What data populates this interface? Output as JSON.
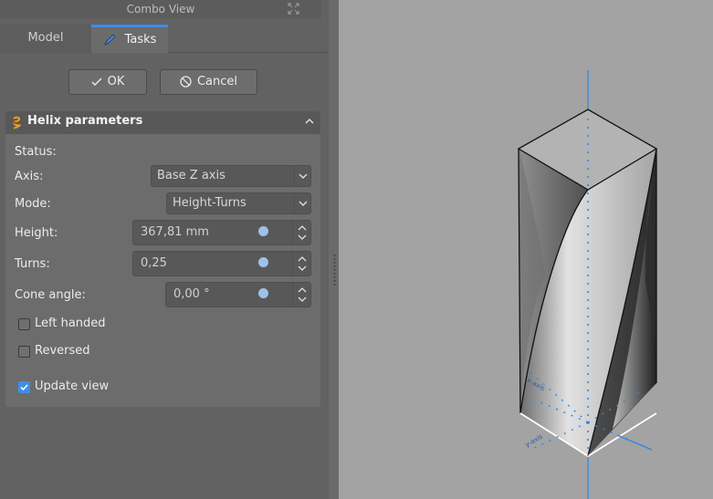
{
  "combo_view": {
    "title": "Combo View",
    "tabs": {
      "model": "Model",
      "tasks": "Tasks"
    }
  },
  "buttons": {
    "ok": "OK",
    "cancel": "Cancel"
  },
  "panel": {
    "title": "Helix parameters",
    "status_label": "Status:",
    "axis_label": "Axis:",
    "axis_value": "Base Z axis",
    "mode_label": "Mode:",
    "mode_value": "Height-Turns",
    "height_label": "Height:",
    "height_value": "367,81 mm",
    "turns_label": "Turns:",
    "turns_value": "0,25",
    "cone_label": "Cone angle:",
    "cone_value": "0,00 °",
    "left_handed_label": "Left handed",
    "left_handed_checked": false,
    "reversed_label": "Reversed",
    "reversed_checked": false,
    "update_view_label": "Update view",
    "update_view_checked": true
  },
  "colors": {
    "accent": "#3e8ee8",
    "viewport_bg": "#a3a3a3",
    "axis_line": "#2a8ae6"
  },
  "icons": {
    "float": "expand-arrows-icon",
    "pencil": "pencil-icon",
    "ok": "checkmark-icon",
    "cancel": "no-entry-icon",
    "helix": "helix-icon",
    "collapse": "chevron-up-icon"
  }
}
